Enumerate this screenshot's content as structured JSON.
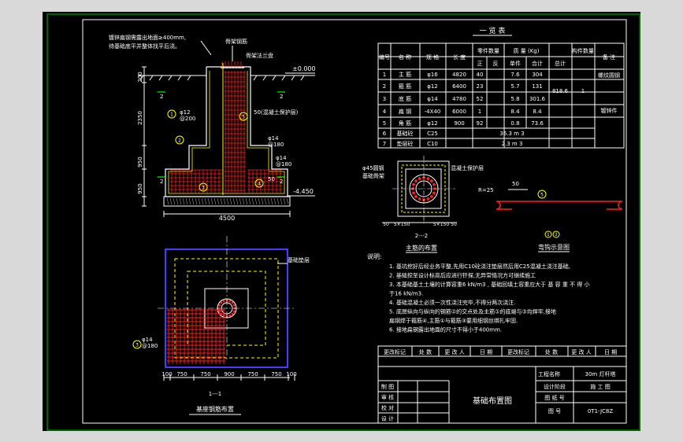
{
  "elevation": {
    "note_line1": "镀锌扁钢需露出地面≥400mm,",
    "note_line2": "待基础底平并整体找平后浇。",
    "cage_label": "骨架钢筋",
    "cage_label2": "骨架法兰盘",
    "level_top": "±0.000",
    "level_bottom": "-4.450",
    "dim_200": "200",
    "dim_2350": "2350",
    "dim_950": "950",
    "dim_450": "950",
    "dim_4500": "4500",
    "rebar_phi12": "φ12",
    "rebar_phi12_spacing": "@200",
    "rebar_phi14a": "φ14",
    "rebar_phi14a_spacing": "@180",
    "rebar_phi14b": "φ14",
    "rebar_phi14b_spacing": "@180",
    "concrete_cover": "50(混凝土保护层)",
    "dim_50": "50",
    "marker_2a": "2",
    "marker_2b": "2",
    "marker_2c": "2",
    "marker_2d": "2",
    "circle_1": "1",
    "circle_2": "2",
    "circle_3": "3",
    "circle_4": "4",
    "circle_5": "5"
  },
  "plan": {
    "label": "基础垫层",
    "rebar": "φ14",
    "rebar_spacing": "@180",
    "circle_3": "3",
    "dims": [
      "100",
      "750",
      "750",
      "900",
      "750",
      "750",
      "100"
    ],
    "section_mark": "1---1",
    "title": "基座钢筋布置"
  },
  "table": {
    "title": "一 览 表",
    "headers": {
      "no": "编号",
      "name": "名 称",
      "spec": "规 格",
      "length": "长 度",
      "count": "零件数量",
      "mass": "质 量 (Kg)",
      "member_count": "构件数量",
      "remark": "备 注",
      "positive": "正",
      "reverse": "反",
      "single": "单件",
      "total": "合计",
      "sum": "总计"
    },
    "rows": [
      {
        "no": "1",
        "name": "主 筋",
        "spec": "φ16",
        "length": "4820",
        "count": "40",
        "single": "7.6",
        "total": "304"
      },
      {
        "no": "2",
        "name": "箍 筋",
        "spec": "φ12",
        "length": "6400",
        "count": "23",
        "single": "5.7",
        "total": "131"
      },
      {
        "no": "3",
        "name": "底 筋",
        "spec": "φ14",
        "length": "4780",
        "count": "52",
        "single": "5.8",
        "total": "301.6"
      },
      {
        "no": "4",
        "name": "扁 钢",
        "spec": "-4X40",
        "length": "6000",
        "count": "1",
        "single": "8.4",
        "total": "8.4"
      },
      {
        "no": "5",
        "name": "角 筋",
        "spec": "φ12",
        "length": "900",
        "count": "92",
        "single": "0.8",
        "total": "73.6"
      }
    ],
    "sum_value": "818.6",
    "member_value": "1",
    "remark1": "螺纹圆钢",
    "remark2": "镀锌件",
    "row6_no": "6",
    "row6_name": "基础砼",
    "row6_spec": "C25",
    "row6_value": "36.3 m 3",
    "row7_no": "7",
    "row7_name": "垫层砼",
    "row7_spec": "C10",
    "row7_value": "2.3 m 3"
  },
  "section22": {
    "label1": "φ45圆钢",
    "label2": "基础骨架",
    "cover": "混凝土保护层",
    "dims": [
      "50",
      "5×150",
      "5×150",
      "50"
    ],
    "mark": "2---2",
    "title": "主筋的布置"
  },
  "hook": {
    "r": "R=25",
    "len": "50",
    "circle": "5",
    "title": "弯钩示意图",
    "mark_a": "1",
    "mark_b": "2"
  },
  "notes": {
    "heading": "说明:",
    "lines": [
      "1. 基坑挖好后经业务平整,先用C10砼浇注垫层然后用C25混凝土浇注基础,",
      "2. 基础挖至设计标高后应进行钎探,无异常情况方可继续施工",
      "3. 本基础基土土壤的计算容重6 kN/m3 , 基础回填土容重应大于 基 容 重 不 得 小",
      "   于16 kN/m3.",
      "4. 基础混凝土必须一次性浇注完毕,不得分两次浇注.",
      "5. 底层纵向与纵向的钢筋②的交点处及主筋①的底端与③均焊牢,接地",
      "   扁钢焊于箍筋④,主筋①与箍筋③要用细钢丝绑扎牢固.",
      "6. 接地扁钢露出地面的尺寸不得小于400mm."
    ]
  },
  "titleblock": {
    "rev_headers": [
      "更改标记",
      "处 数",
      "更 改 人",
      "日 期",
      "更改标记",
      "处 数",
      "更 改 人",
      "日 期"
    ],
    "project_label": "工程名称",
    "project_value": "30m 灯杆塔",
    "draw_title": "基础布置图",
    "left_labels": [
      "制 图",
      "审 核",
      "校 对",
      "设 计"
    ],
    "stage_label": "设计阶段",
    "stage_value": "施 工 图",
    "check_no": "图 纸 号",
    "drawing_no_label": "图 号",
    "drawing_no": "0T1-JC8Z"
  },
  "colors": {
    "frame": "#00c000",
    "white": "#ffffff",
    "yellow": "#ffff00",
    "red": "#ff2020",
    "cyan": "#00ffff",
    "green": "#00ff00",
    "blue": "#4040ff",
    "grey": "#c0c0c0"
  }
}
